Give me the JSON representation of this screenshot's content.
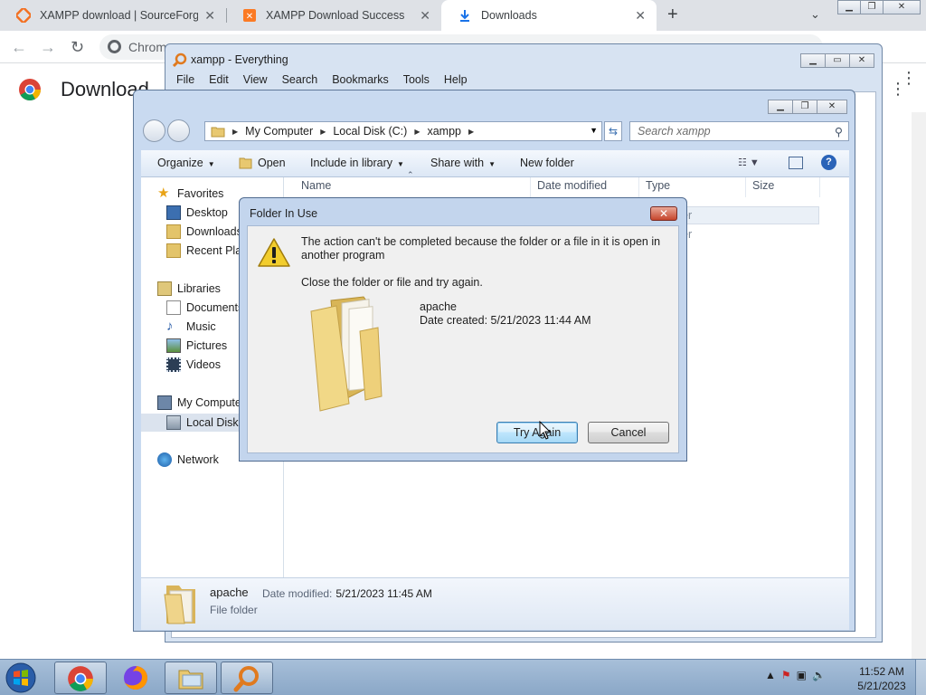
{
  "browser": {
    "tabs": [
      {
        "label": "XAMPP download | SourceForge.",
        "icon": "xampp-icon",
        "active": false
      },
      {
        "label": "XAMPP Download Success",
        "icon": "xampp-icon",
        "active": false
      },
      {
        "label": "Downloads",
        "icon": "download-icon",
        "active": true
      }
    ],
    "omnibox_text": "Chrom",
    "page_title": "Download"
  },
  "everything": {
    "title": "xampp - Everything",
    "menu": [
      "File",
      "Edit",
      "View",
      "Search",
      "Bookmarks",
      "Tools",
      "Help"
    ]
  },
  "explorer": {
    "breadcrumb": [
      "My Computer",
      "Local Disk (C:)",
      "xampp"
    ],
    "search_placeholder": "Search xampp",
    "commands": {
      "organize": "Organize",
      "open": "Open",
      "include": "Include in library",
      "share": "Share with",
      "new_folder": "New folder"
    },
    "columns": [
      "Name",
      "Date modified",
      "Type",
      "Size"
    ],
    "rows_type_partial": [
      "er",
      "er"
    ],
    "nav": {
      "favorites": "Favorites",
      "desktop": "Desktop",
      "downloads": "Downloads",
      "recent": "Recent Plac",
      "libraries": "Libraries",
      "documents": "Documents",
      "music": "Music",
      "pictures": "Pictures",
      "videos": "Videos",
      "computer": "My Compute",
      "local_disk": "Local Disk (",
      "network": "Network"
    },
    "details": {
      "name": "apache",
      "modified_label": "Date modified:",
      "modified_value": "5/21/2023 11:45 AM",
      "type": "File folder"
    }
  },
  "dialog": {
    "title": "Folder In Use",
    "message": "The action can't be completed because the folder or a file in it is open in another program",
    "instruction": "Close the folder or file and try again.",
    "file_name": "apache",
    "file_date": "Date created: 5/21/2023 11:44 AM",
    "try_again": "Try Again",
    "cancel": "Cancel",
    "close_glyph": "✕"
  },
  "taskbar": {
    "time": "11:52 AM",
    "date": "5/21/2023",
    "apps": [
      "chrome-icon",
      "firefox-icon",
      "explorer-icon",
      "everything-icon"
    ]
  },
  "colors": {
    "dialog_frame": "#c3d5ed",
    "close_red": "#c6452c",
    "taskbar": "#8aa7c7"
  }
}
